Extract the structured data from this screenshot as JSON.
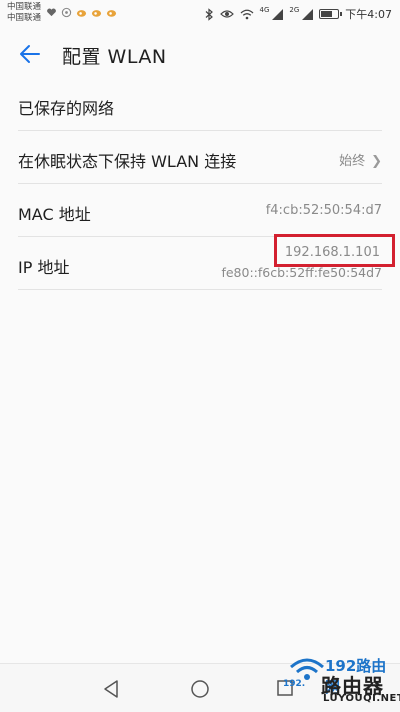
{
  "status_bar": {
    "carrier_1": "中国联通",
    "carrier_2": "中国联通",
    "network_1": "4G",
    "network_2": "2G",
    "time": "下午4:07",
    "battery_level": 0.6
  },
  "header": {
    "title": "配置 WLAN"
  },
  "list": {
    "saved_networks": {
      "label": "已保存的网络"
    },
    "keep_wlan_sleep": {
      "label": "在休眠状态下保持 WLAN 连接",
      "value": "始终"
    },
    "mac": {
      "label": "MAC 地址",
      "value": "f4:cb:52:50:54:d7"
    },
    "ip": {
      "label": "IP 地址",
      "ipv4": "192.168.1.101",
      "ipv6": "fe80::f6cb:52ff:fe50:54d7"
    }
  },
  "watermark": {
    "line1": "192路由网",
    "line2": "路由器",
    "line3": "LUYOUQI.NET",
    "small": "192."
  },
  "colors": {
    "accent": "#1a73e8",
    "highlight": "#d3202f"
  }
}
